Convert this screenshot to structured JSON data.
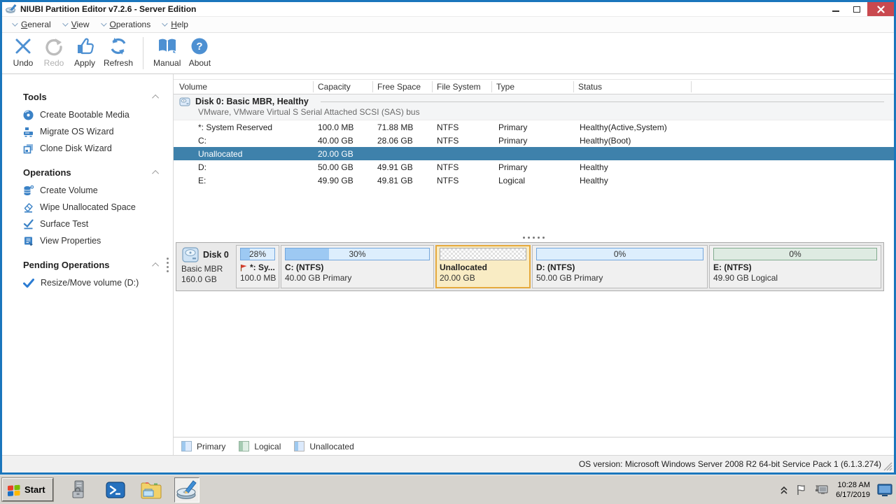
{
  "titlebar": {
    "title": "NIUBI Partition Editor v7.2.6 - Server Edition"
  },
  "menu": {
    "items": [
      {
        "label": "General"
      },
      {
        "label": "View"
      },
      {
        "label": "Operations"
      },
      {
        "label": "Help"
      }
    ]
  },
  "toolbar": {
    "buttons": [
      {
        "label": "Undo"
      },
      {
        "label": "Redo"
      },
      {
        "label": "Apply"
      },
      {
        "label": "Refresh"
      },
      {
        "label": "Manual"
      },
      {
        "label": "About"
      }
    ]
  },
  "sidebar": {
    "sections": [
      {
        "title": "Tools",
        "items": [
          {
            "label": "Create Bootable Media"
          },
          {
            "label": "Migrate OS Wizard"
          },
          {
            "label": "Clone Disk Wizard"
          }
        ]
      },
      {
        "title": "Operations",
        "items": [
          {
            "label": "Create Volume"
          },
          {
            "label": "Wipe Unallocated Space"
          },
          {
            "label": "Surface Test"
          },
          {
            "label": "View Properties"
          }
        ]
      },
      {
        "title": "Pending Operations",
        "items": [
          {
            "label": "Resize/Move volume (D:)"
          }
        ]
      }
    ]
  },
  "volumes_table": {
    "columns": {
      "volume": "Volume",
      "capacity": "Capacity",
      "free_space": "Free Space",
      "file_system": "File System",
      "type": "Type",
      "status": "Status"
    },
    "disk_group": {
      "title": "Disk 0: Basic MBR, Healthy",
      "subtitle": "VMware, VMware Virtual S Serial Attached SCSI (SAS) bus"
    },
    "rows": [
      {
        "volume": "*: System Reserved",
        "capacity": "100.0 MB",
        "free": "71.88 MB",
        "fs": "NTFS",
        "type": "Primary",
        "status": "Healthy(Active,System)"
      },
      {
        "volume": "C:",
        "capacity": "40.00 GB",
        "free": "28.06 GB",
        "fs": "NTFS",
        "type": "Primary",
        "status": "Healthy(Boot)"
      },
      {
        "volume": "Unallocated",
        "capacity": "20.00 GB",
        "free": "",
        "fs": "",
        "type": "",
        "status": ""
      },
      {
        "volume": "D:",
        "capacity": "50.00 GB",
        "free": "49.91 GB",
        "fs": "NTFS",
        "type": "Primary",
        "status": "Healthy"
      },
      {
        "volume": "E:",
        "capacity": "49.90 GB",
        "free": "49.81 GB",
        "fs": "NTFS",
        "type": "Logical",
        "status": "Healthy"
      }
    ]
  },
  "disk_map": {
    "disk_name": "Disk 0",
    "disk_type": "Basic MBR",
    "disk_size": "160.0 GB",
    "partitions": [
      {
        "label": "*: Sy...",
        "info": "100.0 MB",
        "usage": "28%"
      },
      {
        "label": "C: (NTFS)",
        "info": "40.00 GB Primary",
        "usage": "30%"
      },
      {
        "label": "Unallocated",
        "info": "20.00 GB",
        "usage": ""
      },
      {
        "label": "D: (NTFS)",
        "info": "50.00 GB Primary",
        "usage": "0%"
      },
      {
        "label": "E: (NTFS)",
        "info": "49.90 GB Logical",
        "usage": "0%"
      }
    ]
  },
  "legend": {
    "primary": "Primary",
    "logical": "Logical",
    "unallocated": "Unallocated"
  },
  "statusbar": {
    "os_version": "OS version: Microsoft Windows Server 2008 R2  64-bit Service Pack 1 (6.1.3.274)"
  },
  "taskbar": {
    "start": "Start",
    "clock_time": "10:28 AM",
    "clock_date": "6/17/2019"
  }
}
